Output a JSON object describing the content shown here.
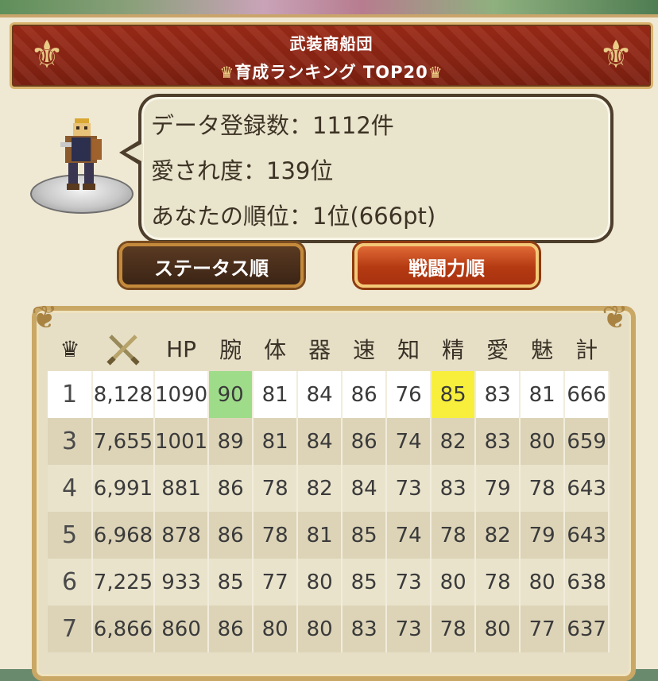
{
  "header": {
    "title": "武装商船団",
    "subtitle": "育成ランキング TOP20"
  },
  "info": {
    "data_count": "データ登録数：1112件",
    "affection": "愛され度：139位",
    "your_rank": "あなたの順位：1位(666pt)"
  },
  "sort_buttons": {
    "status": "ステータス順",
    "power": "戦闘力順"
  },
  "table": {
    "headers": [
      "HP",
      "腕",
      "体",
      "器",
      "速",
      "知",
      "精",
      "愛",
      "魅",
      "計"
    ],
    "rows": [
      {
        "rank": "1",
        "power": "8,128",
        "hp": "1090",
        "stats": [
          "90",
          "81",
          "84",
          "86",
          "76",
          "85",
          "83",
          "81"
        ],
        "total": "666"
      },
      {
        "rank": "3",
        "power": "7,655",
        "hp": "1001",
        "stats": [
          "89",
          "81",
          "84",
          "86",
          "74",
          "82",
          "83",
          "80"
        ],
        "total": "659"
      },
      {
        "rank": "4",
        "power": "6,991",
        "hp": "881",
        "stats": [
          "86",
          "78",
          "82",
          "84",
          "73",
          "83",
          "79",
          "78"
        ],
        "total": "643"
      },
      {
        "rank": "5",
        "power": "6,968",
        "hp": "878",
        "stats": [
          "86",
          "78",
          "81",
          "85",
          "74",
          "78",
          "82",
          "79"
        ],
        "total": "643"
      },
      {
        "rank": "6",
        "power": "7,225",
        "hp": "933",
        "stats": [
          "85",
          "77",
          "80",
          "85",
          "73",
          "80",
          "78",
          "80"
        ],
        "total": "638"
      },
      {
        "rank": "7",
        "power": "6,866",
        "hp": "860",
        "stats": [
          "86",
          "80",
          "80",
          "83",
          "73",
          "78",
          "80",
          "77"
        ],
        "total": "637"
      }
    ]
  },
  "colors": {
    "header_red": "#8a2414",
    "highlight_green": "#9fdc8a",
    "highlight_yellow": "#f7ef3c",
    "active_button": "#b43a12"
  },
  "icons": {
    "crown": "crown-icon",
    "swords": "crossed-swords-icon"
  }
}
